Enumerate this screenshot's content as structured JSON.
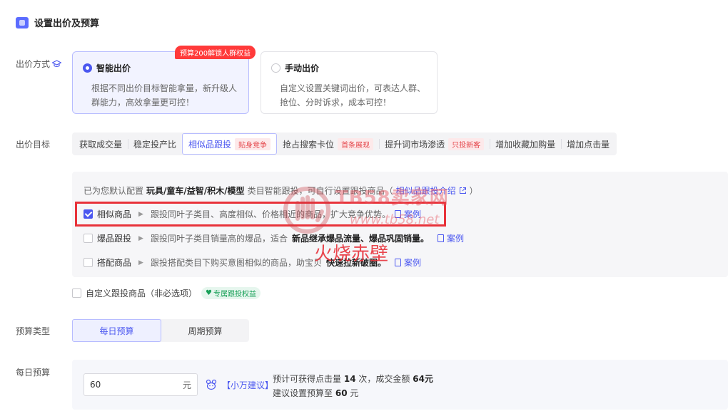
{
  "section": {
    "title": "设置出价及预算"
  },
  "bid_method": {
    "label": "出价方式",
    "badge": "预算200解锁人群权益",
    "options": [
      {
        "title": "智能出价",
        "desc": "根据不同出价目标智能拿量，新升级人群能力，高效拿量更可控！",
        "selected": true
      },
      {
        "title": "手动出价",
        "desc": "自定义设置关键词出价，可表达人群、抢位、分时诉求，成本可控！",
        "selected": false
      }
    ]
  },
  "bid_target": {
    "label": "出价目标",
    "tabs": [
      {
        "label": "获取成交量",
        "tag": ""
      },
      {
        "label": "稳定投产比",
        "tag": ""
      },
      {
        "label": "相似品跟投",
        "tag": "贴身竞争",
        "active": true
      },
      {
        "label": "抢占搜索卡位",
        "tag": "首条展现"
      },
      {
        "label": "提升词市场渗透",
        "tag": "只投新客"
      },
      {
        "label": "增加收藏加购量",
        "tag": ""
      },
      {
        "label": "增加点击量",
        "tag": ""
      }
    ]
  },
  "similar": {
    "intro_prefix": "已为您默认配置",
    "category": "玩具/童车/益智/积木/模型",
    "intro_mid": "类目智能跟投，可自行设置跟投商品（",
    "intro_link": "相似品跟投介绍",
    "intro_suffix": "）",
    "options": [
      {
        "name": "相似商品",
        "desc": "跟投同叶子类目、高度相似、价格相近的商品，扩大竞争优势。",
        "bold": "",
        "desc_after": "",
        "case": "案例",
        "checked": true
      },
      {
        "name": "爆品跟投",
        "desc": "跟投同叶子类目销量高的爆品，适合",
        "bold": "新品继承爆品流量、爆品巩固销量。",
        "desc_after": "",
        "case": "案例",
        "checked": false
      },
      {
        "name": "搭配商品",
        "desc": "跟投搭配类目下购买意图相似的商品，助宝贝",
        "bold": "快速拉新破圈。",
        "desc_after": "",
        "case": "案例",
        "checked": false
      }
    ],
    "custom_label": "自定义跟投商品（非必选项）",
    "custom_tag": "专属跟投权益"
  },
  "budget_type": {
    "label": "预算类型",
    "options": [
      "每日预算",
      "周期预算"
    ],
    "active": 0
  },
  "daily_budget": {
    "label": "每日预算",
    "value": "60",
    "unit": "元",
    "advice_tag": "【小万建议】",
    "line1_a": "预计可获得点击量",
    "line1_clicks": "14",
    "line1_b": "次，成交金额",
    "line1_amount": "64元",
    "line2_a": "建议设置预算至",
    "line2_value": "60",
    "line2_b": "元"
  },
  "watermark": {
    "site": "TB58卖家网",
    "url": "www.tb58.net",
    "caption": "火烧赤壁"
  },
  "colors": {
    "accent": "#4b57f0",
    "danger": "#e8323a",
    "success": "#18a058"
  }
}
